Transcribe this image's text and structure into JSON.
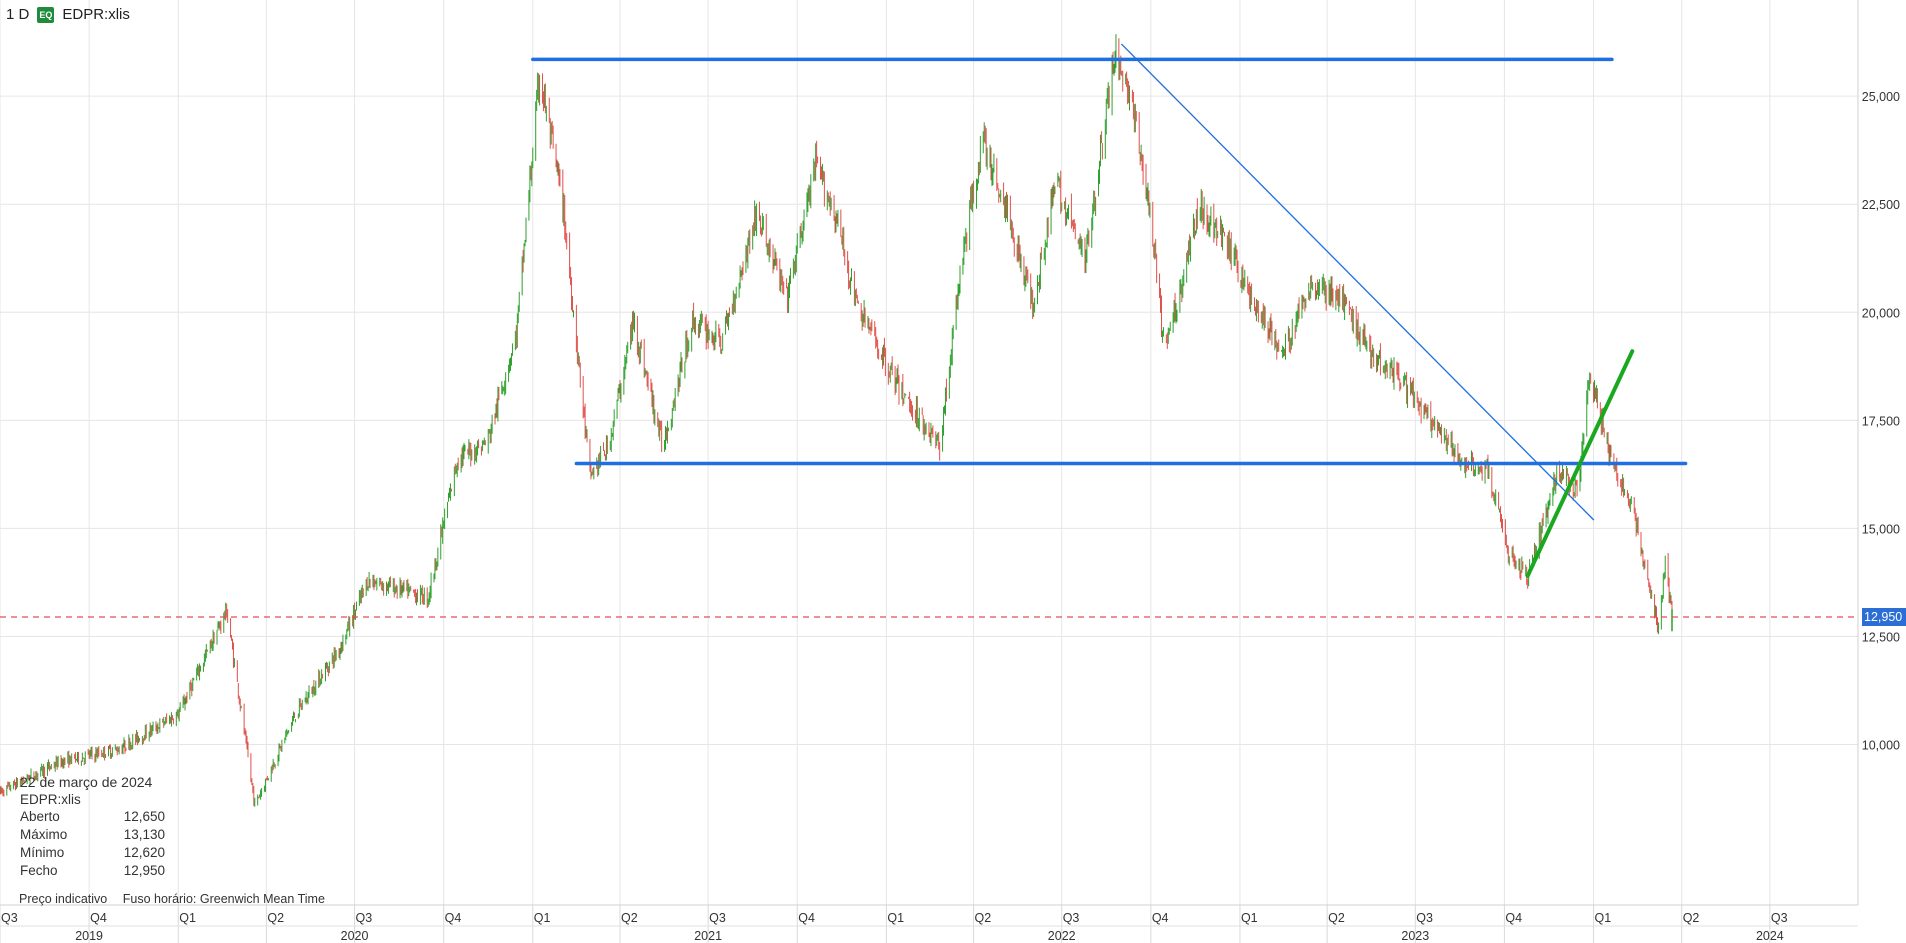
{
  "header": {
    "interval": "1 D",
    "badge": "EQ",
    "symbol": "EDPR:xlis"
  },
  "info_box": {
    "date": "22 de março de 2024",
    "symbol": "EDPR:xlis",
    "rows": [
      {
        "label": "Aberto",
        "value": "12,650"
      },
      {
        "label": "Máximo",
        "value": "13,130"
      },
      {
        "label": "Mínimo",
        "value": "12,620"
      },
      {
        "label": "Fecho",
        "value": "12,950"
      }
    ],
    "footer_left": "Preço indicativo",
    "footer_right": "Fuso horário: Greenwich Mean Time"
  },
  "colors": {
    "up": "#2ca02c",
    "down": "#e0504a",
    "grid": "#e6e6e6",
    "support_line": "#1f6fe0",
    "trend_line": "#1f6fe0",
    "green_trend": "#19a81f",
    "last_price_line": "#e05050",
    "tag_bg": "#2b6fd6"
  },
  "chart_data": {
    "type": "candlestick",
    "ylim": [
      8.2,
      27.0
    ],
    "yticks": [
      "25,000",
      "22,500",
      "20,000",
      "17,500",
      "15,000",
      "12,500",
      "10,000"
    ],
    "ytick_values": [
      25,
      22.5,
      20,
      17.5,
      15,
      12.5,
      10
    ],
    "last_price": "12,950",
    "last_price_value": 12.95,
    "x_range": [
      "2019-07-01",
      "2024-09-30"
    ],
    "quarters": [
      {
        "label": "Q3",
        "date": "2019-07-01"
      },
      {
        "label": "Q4",
        "date": "2019-10-01"
      },
      {
        "label": "Q1",
        "date": "2020-01-01"
      },
      {
        "label": "Q2",
        "date": "2020-04-01"
      },
      {
        "label": "Q3",
        "date": "2020-07-01"
      },
      {
        "label": "Q4",
        "date": "2020-10-01"
      },
      {
        "label": "Q1",
        "date": "2021-01-01"
      },
      {
        "label": "Q2",
        "date": "2021-04-01"
      },
      {
        "label": "Q3",
        "date": "2021-07-01"
      },
      {
        "label": "Q4",
        "date": "2021-10-01"
      },
      {
        "label": "Q1",
        "date": "2022-01-01"
      },
      {
        "label": "Q2",
        "date": "2022-04-01"
      },
      {
        "label": "Q3",
        "date": "2022-07-01"
      },
      {
        "label": "Q4",
        "date": "2022-10-01"
      },
      {
        "label": "Q1",
        "date": "2023-01-01"
      },
      {
        "label": "Q2",
        "date": "2023-04-01"
      },
      {
        "label": "Q3",
        "date": "2023-07-01"
      },
      {
        "label": "Q4",
        "date": "2023-10-01"
      },
      {
        "label": "Q1",
        "date": "2024-01-01"
      },
      {
        "label": "Q2",
        "date": "2024-04-01"
      },
      {
        "label": "Q3",
        "date": "2024-07-01"
      }
    ],
    "years": [
      {
        "label": "2019",
        "date": "2019-10-01"
      },
      {
        "label": "2020",
        "date": "2020-07-01"
      },
      {
        "label": "2021",
        "date": "2021-07-01"
      },
      {
        "label": "2022",
        "date": "2022-07-01"
      },
      {
        "label": "2023",
        "date": "2023-07-01"
      },
      {
        "label": "2024",
        "date": "2024-07-01"
      }
    ],
    "price_path": [
      [
        "2019-07-01",
        8.9
      ],
      [
        "2019-09-01",
        9.6
      ],
      [
        "2019-11-01",
        9.9
      ],
      [
        "2020-01-01",
        10.7
      ],
      [
        "2020-02-20",
        13.1
      ],
      [
        "2020-03-20",
        8.6
      ],
      [
        "2020-05-01",
        10.7
      ],
      [
        "2020-06-15",
        12.2
      ],
      [
        "2020-07-15",
        13.8
      ],
      [
        "2020-09-15",
        13.4
      ],
      [
        "2020-10-15",
        16.6
      ],
      [
        "2020-11-15",
        17.0
      ],
      [
        "2020-12-15",
        19.5
      ],
      [
        "2021-01-08",
        25.5
      ],
      [
        "2021-02-01",
        22.5
      ],
      [
        "2021-03-01",
        16.2
      ],
      [
        "2021-03-20",
        16.9
      ],
      [
        "2021-04-15",
        19.8
      ],
      [
        "2021-05-15",
        16.9
      ],
      [
        "2021-06-15",
        19.8
      ],
      [
        "2021-07-15",
        19.3
      ],
      [
        "2021-08-20",
        22.3
      ],
      [
        "2021-09-20",
        20.3
      ],
      [
        "2021-10-20",
        23.4
      ],
      [
        "2021-11-10",
        22.2
      ],
      [
        "2021-12-01",
        20.2
      ],
      [
        "2022-01-15",
        18.2
      ],
      [
        "2022-02-25",
        16.9
      ],
      [
        "2022-03-20",
        21.2
      ],
      [
        "2022-04-10",
        24.0
      ],
      [
        "2022-05-10",
        22.0
      ],
      [
        "2022-06-01",
        20.2
      ],
      [
        "2022-06-25",
        23.0
      ],
      [
        "2022-07-25",
        21.2
      ],
      [
        "2022-08-25",
        26.0
      ],
      [
        "2022-09-10",
        25.0
      ],
      [
        "2022-09-30",
        22.3
      ],
      [
        "2022-10-15",
        19.1
      ],
      [
        "2022-11-01",
        20.6
      ],
      [
        "2022-11-20",
        22.5
      ],
      [
        "2022-12-20",
        21.5
      ],
      [
        "2023-01-15",
        20.2
      ],
      [
        "2023-02-15",
        19.0
      ],
      [
        "2023-03-15",
        20.7
      ],
      [
        "2023-04-15",
        20.3
      ],
      [
        "2023-05-15",
        19.1
      ],
      [
        "2023-06-15",
        18.5
      ],
      [
        "2023-07-15",
        17.5
      ],
      [
        "2023-08-15",
        16.6
      ],
      [
        "2023-09-15",
        16.3
      ],
      [
        "2023-10-05",
        14.4
      ],
      [
        "2023-10-25",
        13.9
      ],
      [
        "2023-11-25",
        16.3
      ],
      [
        "2023-12-15",
        15.9
      ],
      [
        "2023-12-28",
        18.6
      ],
      [
        "2024-01-20",
        16.5
      ],
      [
        "2024-02-10",
        15.5
      ],
      [
        "2024-02-28",
        13.6
      ],
      [
        "2024-03-08",
        12.6
      ],
      [
        "2024-03-15",
        14.2
      ],
      [
        "2024-03-22",
        12.95
      ]
    ],
    "annotation_lines": [
      {
        "kind": "horizontal",
        "from": "2021-01-01",
        "to": "2024-01-20",
        "y": 25.85,
        "color_key": "support_line",
        "width": 3.5
      },
      {
        "kind": "horizontal",
        "from": "2021-02-15",
        "to": "2024-04-05",
        "y": 16.5,
        "color_key": "support_line",
        "width": 3.5
      },
      {
        "kind": "trend",
        "from": [
          "2022-09-01",
          26.2
        ],
        "to": [
          "2024-01-01",
          15.2
        ],
        "color_key": "trend_line",
        "width": 1.3
      },
      {
        "kind": "trend",
        "from": [
          "2023-10-25",
          13.9
        ],
        "to": [
          "2024-02-10",
          19.1
        ],
        "color_key": "green_trend",
        "width": 4
      }
    ]
  }
}
